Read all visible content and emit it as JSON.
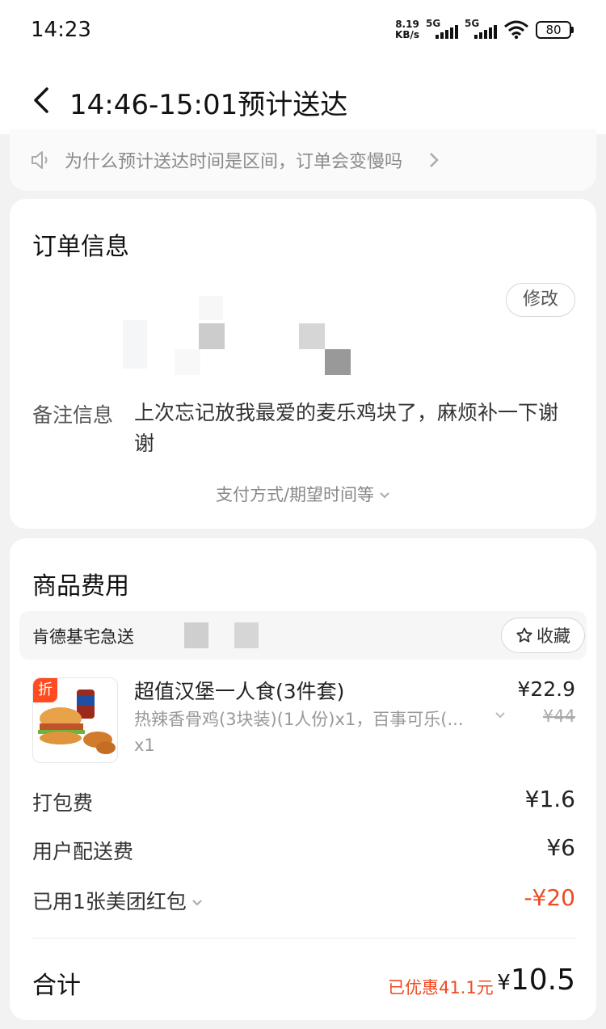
{
  "status_bar": {
    "time": "14:23",
    "net_speed_value": "8.19",
    "net_speed_unit": "KB/s",
    "sim1": "5G",
    "sim2": "5G",
    "battery": "80"
  },
  "header": {
    "title": "14:46-15:01预计送达"
  },
  "notice": {
    "text": "为什么预计送达时间是区间，订单会变慢吗"
  },
  "order_info": {
    "title": "订单信息",
    "modify_label": "修改",
    "remark_label": "备注信息",
    "remark_text": "上次忘记放我最爱的麦乐鸡块了，麻烦补一下谢谢",
    "more_toggle": "支付方式/期望时间等"
  },
  "fees": {
    "title": "商品费用",
    "store_name": "肯德基宅急送",
    "favorite_label": "收藏",
    "product": {
      "tag": "折",
      "name": "超值汉堡一人食(3件套)",
      "desc": "热辣香骨鸡(3块装)(1人份)x1，百事可乐(...",
      "qty": "x1",
      "price": "¥22.9",
      "orig_price": "¥44"
    },
    "packing_label": "打包费",
    "packing_value": "¥1.6",
    "delivery_label": "用户配送费",
    "delivery_value": "¥6",
    "coupon_label": "已用1张美团红包",
    "coupon_value": "-¥20",
    "total_label": "合计",
    "saved_text": "已优惠41.1元",
    "total_currency": "¥",
    "total_value": "10.5"
  },
  "colors": {
    "accent_red": "#ef4a22",
    "tag_orange": "#ff4b1f"
  }
}
